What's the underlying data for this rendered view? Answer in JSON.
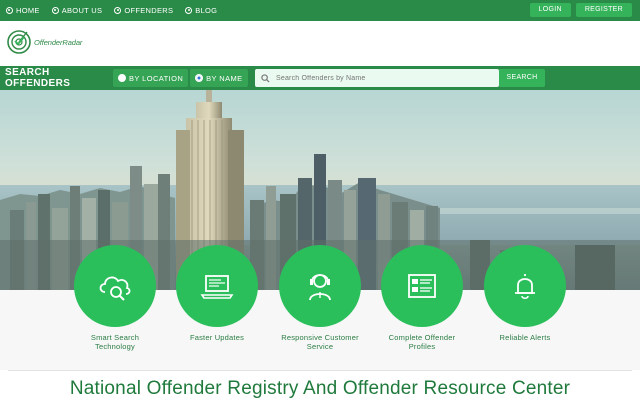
{
  "topnav": {
    "items": [
      {
        "label": "HOME"
      },
      {
        "label": "ABOUT US"
      },
      {
        "label": "OFFENDERS"
      },
      {
        "label": "BLOG"
      }
    ],
    "login_label": "LOGIN",
    "register_label": "REGISTER"
  },
  "brand": {
    "logo_text": "OffenderRadar",
    "accent": "#2a8a47",
    "button_green": "#35b35b",
    "circle_green": "#2bbf5c"
  },
  "search": {
    "title": "SEARCH OFFENDERS",
    "options": [
      {
        "label": "BY LOCATION",
        "selected": false
      },
      {
        "label": "BY NAME",
        "selected": true
      }
    ],
    "placeholder": "Search Offenders by Name",
    "button_label": "SEARCH"
  },
  "features": [
    {
      "icon": "cloud-search-icon",
      "label_line1": "Smart Search",
      "label_line2": "Technology"
    },
    {
      "icon": "laptop-icon",
      "label_line1": "Faster Updates",
      "label_line2": ""
    },
    {
      "icon": "headset-agent-icon",
      "label_line1": "Responsive Customer",
      "label_line2": "Service"
    },
    {
      "icon": "profile-card-icon",
      "label_line1": "Complete Offender",
      "label_line2": "Profiles"
    },
    {
      "icon": "bell-icon",
      "label_line1": "Reliable Alerts",
      "label_line2": ""
    }
  ],
  "headline": "National Offender Registry And Offender Resource Center"
}
